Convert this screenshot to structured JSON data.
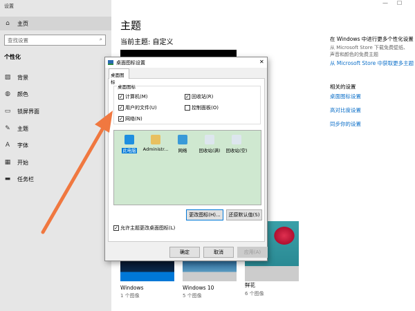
{
  "window": {
    "title": "设置",
    "minimize": "—",
    "maximize": "☐"
  },
  "sidebar": {
    "home": "主页",
    "search_placeholder": "查找设置",
    "section": "个性化",
    "items": [
      {
        "label": "背景",
        "icon": "image-icon"
      },
      {
        "label": "颜色",
        "icon": "palette-icon"
      },
      {
        "label": "锁屏界面",
        "icon": "lockscreen-icon"
      },
      {
        "label": "主题",
        "icon": "theme-icon"
      },
      {
        "label": "字体",
        "icon": "font-icon"
      },
      {
        "label": "开始",
        "icon": "start-icon"
      },
      {
        "label": "任务栏",
        "icon": "taskbar-icon"
      }
    ]
  },
  "main": {
    "title": "主题",
    "current": "当前主题: 自定义",
    "themes": [
      {
        "name": "Windows",
        "count": "1 个图像"
      },
      {
        "name": "Windows 10",
        "count": "5 个图像"
      },
      {
        "name": "鲜花",
        "count": "6 个图像"
      }
    ]
  },
  "right": {
    "heading": "在 Windows 中进行更多个性化设置",
    "desc": "从 Microsoft Store 下载免费壁纸、声音和颜色的免费主题",
    "store_link": "从 Microsoft Store 中获取更多主题",
    "related": "相关的设置",
    "links": [
      "桌面图标设置",
      "高对比度设置",
      "同步你的设置"
    ]
  },
  "dialog": {
    "title": "桌面图标设置",
    "close": "✕",
    "tab": "桌面图标",
    "group": "桌面图标",
    "checkboxes": [
      {
        "label": "计算机(M)",
        "checked": true
      },
      {
        "label": "回收站(R)",
        "checked": true
      },
      {
        "label": "用户的文件(U)",
        "checked": true
      },
      {
        "label": "控制面板(O)",
        "checked": false
      },
      {
        "label": "网络(N)",
        "checked": true
      }
    ],
    "icons": [
      "此电脑",
      "Administr...",
      "网络",
      "回收站(满)",
      "回收站(空)"
    ],
    "change_icon": "更改图标(H)...",
    "restore": "还原默认值(S)",
    "allow_themes": "允许主题更改桌面图标(L)",
    "ok": "确定",
    "cancel": "取消",
    "apply": "应用(A)",
    "check": "✓"
  },
  "colors": {
    "accent": "#0078d7",
    "arrow": "#f07840",
    "list_bg": "#cfe8d0"
  }
}
